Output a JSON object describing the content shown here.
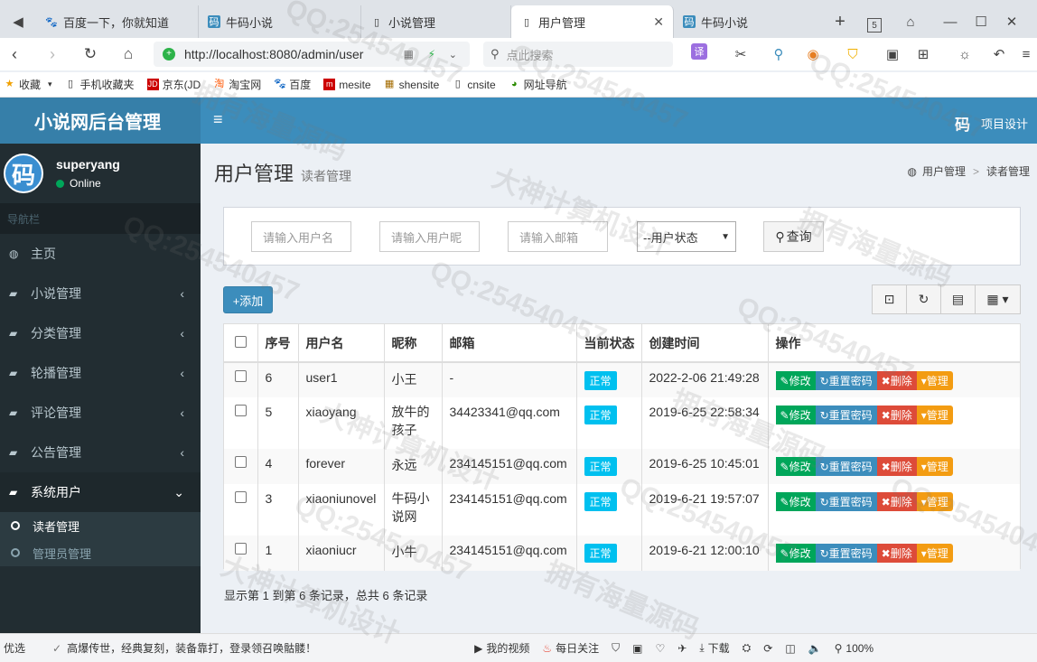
{
  "browser": {
    "tabs": [
      {
        "label": "百度一下，你就知道",
        "icon": "paw-icon"
      },
      {
        "label": "牛码小说",
        "icon": "site-icon"
      },
      {
        "label": "小说管理",
        "icon": "doc-icon"
      },
      {
        "label": "用户管理",
        "icon": "doc-icon",
        "active": true
      },
      {
        "label": "牛码小说",
        "icon": "site-icon"
      }
    ],
    "tab_count": "5",
    "url": "http://localhost:8080/admin/user",
    "search_placeholder": "点此搜索",
    "bookmarks": [
      "收藏",
      "手机收藏夹",
      "京东(JD",
      "淘宝网",
      "百度",
      "mesite",
      "shensite",
      "cnsite",
      "网址导航"
    ]
  },
  "app": {
    "logo": "小说网后台管理",
    "project_design": "项目设计",
    "user": {
      "name": "superyang",
      "status": "Online",
      "avatar_text": "码"
    },
    "nav_header": "导航栏",
    "menu": [
      {
        "label": "主页",
        "icon": "dashboard-icon"
      },
      {
        "label": "小说管理",
        "icon": "book-icon"
      },
      {
        "label": "分类管理",
        "icon": "book-icon"
      },
      {
        "label": "轮播管理",
        "icon": "book-icon"
      },
      {
        "label": "评论管理",
        "icon": "book-icon"
      },
      {
        "label": "公告管理",
        "icon": "book-icon"
      },
      {
        "label": "系统用户",
        "icon": "book-icon"
      }
    ],
    "submenu": [
      {
        "label": "读者管理"
      },
      {
        "label": "管理员管理"
      }
    ]
  },
  "page": {
    "title": "用户管理",
    "subtitle": "读者管理",
    "breadcrumb": [
      "用户管理",
      "读者管理"
    ],
    "filters": {
      "username_placeholder": "请输入用户名",
      "nickname_placeholder": "请输入用户昵",
      "email_placeholder": "请输入邮箱",
      "status_select": "--用户状态",
      "query_button": "查询"
    },
    "add_button": "+添加",
    "table": {
      "headers": [
        "序号",
        "用户名",
        "昵称",
        "邮箱",
        "当前状态",
        "创建时间",
        "操作"
      ],
      "rows": [
        {
          "id": "6",
          "username": "user1",
          "nickname": "小王",
          "email": "-",
          "status": "正常",
          "created": "2022-2-06 21:49:28"
        },
        {
          "id": "5",
          "username": "xiaoyang",
          "nickname": "放牛的孩子",
          "email": "34423341@qq.com",
          "status": "正常",
          "created": "2019-6-25 22:58:34"
        },
        {
          "id": "4",
          "username": "forever",
          "nickname": "永远",
          "email": "234145151@qq.com",
          "status": "正常",
          "created": "2019-6-25 10:45:01"
        },
        {
          "id": "3",
          "username": "xiaoniunovel",
          "nickname": "牛码小说网",
          "email": "234145151@qq.com",
          "status": "正常",
          "created": "2019-6-21 19:57:07"
        },
        {
          "id": "1",
          "username": "xiaoniucr",
          "nickname": "小牛",
          "email": "234145151@qq.com",
          "status": "正常",
          "created": "2019-6-21 12:00:10"
        }
      ],
      "actions": {
        "edit": "修改",
        "reset": "重置密码",
        "delete": "删除",
        "manage": "管理"
      }
    },
    "pagination_info": "显示第 1 到第 6 条记录，总共 6 条记录"
  },
  "statusbar": {
    "left": "优选",
    "ticker": "高爆传世，经典复刻，装备靠打，登录领召唤骷髅！",
    "my_video": "我的视频",
    "daily_focus": "每日关注",
    "download": "下载",
    "zoom": "100%"
  },
  "watermark": {
    "qq": "QQ:254540457",
    "text1": "大神计算机设计",
    "text2": "拥有海量源码"
  }
}
